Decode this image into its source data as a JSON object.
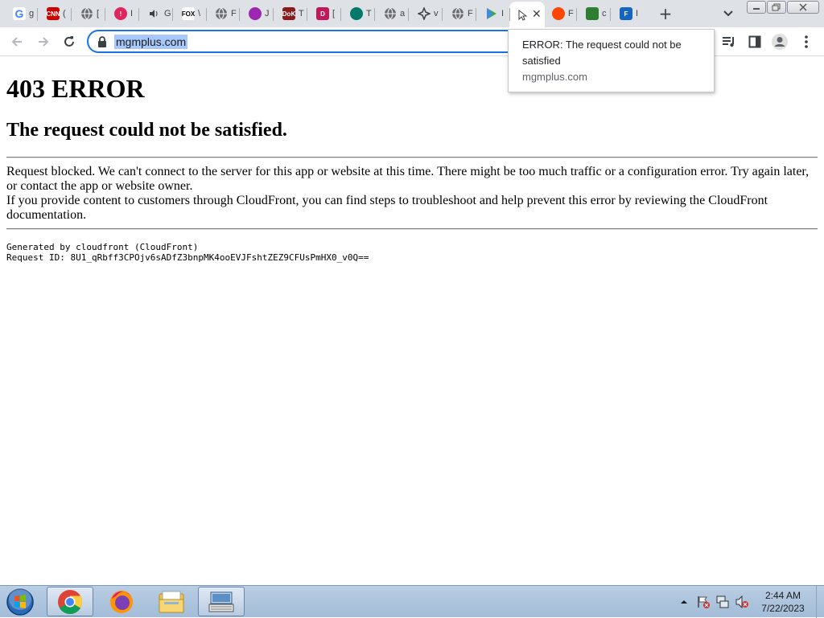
{
  "browser": {
    "tabs": [
      {
        "icon": "google-icon",
        "favicon_text": "G",
        "color": "#ffffff",
        "frag": "g"
      },
      {
        "icon": "cnn-icon",
        "favicon_text": "CNN",
        "color": "#cc0000",
        "frag": "("
      },
      {
        "icon": "globe-icon",
        "favicon_text": "",
        "color": "#5f6368",
        "frag": "["
      },
      {
        "icon": "red-circle-icon",
        "favicon_text": "!",
        "color": "#e0245e",
        "frag": "I"
      },
      {
        "icon": "speaker-icon",
        "favicon_text": "",
        "color": "#ffffff",
        "frag": "G"
      },
      {
        "icon": "fox-icon",
        "favicon_text": "FOX",
        "color": "#ffffff",
        "frag": "\\"
      },
      {
        "icon": "globe-icon",
        "favicon_text": "",
        "color": "#5f6368",
        "frag": "F"
      },
      {
        "icon": "heart-icon",
        "favicon_text": "",
        "color": "#9c27b0",
        "frag": "J"
      },
      {
        "icon": "dok-icon",
        "favicon_text": "DoK",
        "color": "#8b1a1a",
        "frag": "T"
      },
      {
        "icon": "roku-icon",
        "favicon_text": "D",
        "color": "#c2185b",
        "frag": "["
      },
      {
        "icon": "teal-circle-icon",
        "favicon_text": "",
        "color": "#00796b",
        "frag": "T"
      },
      {
        "icon": "globe-icon",
        "favicon_text": "",
        "color": "#5f6368",
        "frag": "a"
      },
      {
        "icon": "puzzle-icon",
        "favicon_text": "",
        "color": "#3c4043",
        "frag": "v"
      },
      {
        "icon": "globe-icon",
        "favicon_text": "",
        "color": "#5f6368",
        "frag": "F"
      },
      {
        "icon": "play-icon",
        "favicon_text": "",
        "color": "#34a853",
        "frag": "I"
      },
      {
        "icon": "loading-icon",
        "favicon_text": "",
        "color": "#ffffff",
        "frag": ""
      },
      {
        "icon": "reddit-icon",
        "favicon_text": "",
        "color": "#ff4500",
        "frag": "F"
      },
      {
        "icon": "green-logo-icon",
        "favicon_text": "",
        "color": "#2e7d32",
        "frag": "c"
      },
      {
        "icon": "f-icon",
        "favicon_text": "F",
        "color": "#1565c0",
        "frag": "I"
      }
    ],
    "new_tab_label": "+",
    "url": "mgmplus.com"
  },
  "tooltip": {
    "title": "ERROR: The request could not be satisfied",
    "url": "mgmplus.com"
  },
  "page": {
    "h1": "403 ERROR",
    "h2": "The request could not be satisfied.",
    "p1": "Request blocked. We can't connect to the server for this app or website at this time. There might be too much traffic or a configuration error. Try again later, or contact the app or website owner.",
    "p2": "If you provide content to customers through CloudFront, you can find steps to troubleshoot and help prevent this error by reviewing the CloudFront documentation.",
    "footer_line1": "Generated by cloudfront (CloudFront)",
    "footer_line2": "Request ID: 8U1_qRbff3CPOjv6sADfZ3bnpMK4ooEVJFshtZEZ9CFUsPmHX0_v0Q=="
  },
  "taskbar": {
    "time": "2:44 AM",
    "date": "7/22/2023"
  }
}
